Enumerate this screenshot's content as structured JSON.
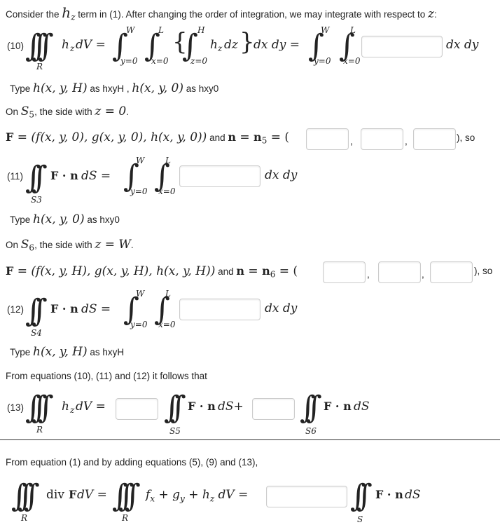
{
  "intro": {
    "text1": "Consider the ",
    "hz": "h",
    "z": "z",
    "text2": " term in (1). After changing the order of integration, we may integrate with respect to ",
    "var": "z",
    ":": ":"
  },
  "eq10": {
    "label": "(10)",
    "region": "R",
    "lhs": "h",
    "dv": " dV =",
    "W": "W",
    "L": "L",
    "H": "H",
    "y0": "y=0",
    "x0": "x=0",
    "z0": "z=0",
    "inner": "h",
    "dz": "dz",
    "dxdy": "dx dy =",
    "dxdy2": "dx dy"
  },
  "type1": {
    "pre": "Type ",
    "e1": "h(x, y, H)",
    "m1": " as hxyH , ",
    "e2": "h(x, y, 0)",
    "m2": " as hxy0"
  },
  "s5": {
    "pre": "On ",
    "S": "S",
    "sub": "5",
    "mid": ", the side with ",
    "eq": "z = 0",
    "post": "."
  },
  "f5": {
    "F": "F",
    "expr": " = (f(x, y, 0), g(x, y, 0), h(x, y, 0))",
    "and": " and ",
    "n": "n",
    "eq": " = ",
    "n5": "n",
    "sub": "5",
    "open": " = (",
    "comma": ",",
    "close": "), so"
  },
  "eq11": {
    "label": "(11)",
    "region": "S3",
    "Fn": "F · n",
    "dS": " dS =",
    "W": "W",
    "L": "L",
    "y0": "y=0",
    "x0": "x=0",
    "dxdy": "dx dy"
  },
  "type2": {
    "pre": "Type ",
    "e": "h(x, y, 0)",
    "post": " as hxy0"
  },
  "s6": {
    "pre": "On ",
    "S": "S",
    "sub": "6",
    "mid": ", the side with ",
    "eq": "z = W",
    "post": "."
  },
  "f6": {
    "F": "F",
    "expr": " = (f(x, y, H), g(x, y, H), h(x, y, H))",
    "and": " and ",
    "n": "n",
    "n6": "n",
    "sub": "6",
    "open": " = (",
    "comma": ",",
    "close": "), so"
  },
  "eq12": {
    "label": "(12)",
    "region": "S4",
    "Fn": "F · n",
    "dS": " dS =",
    "W": "W",
    "L": "L",
    "y0": "y=0",
    "x0": "x=0",
    "dxdy": "dx dy"
  },
  "type3": {
    "pre": "Type ",
    "e": "h(x, y, H)",
    "post": " as hxyH"
  },
  "from1": "From equations (10), (11) and (12) it follows that",
  "eq13": {
    "label": "(13)",
    "region": "R",
    "lhs": "h",
    "dv": " dV =",
    "Fn": "F · n",
    "dS1": " dS+",
    "dS2": " dS",
    "S5": "S5",
    "S6": "S6"
  },
  "from2": "From equation (1) and by adding equations (5), (9) and (13),",
  "final": {
    "div": "div",
    "F": "F",
    "dv": " dV =",
    "sum": "f",
    "x": "x",
    "plus1": " + g",
    "y": "y",
    "plus2": " + h",
    "z": "z",
    "dv2": " dV =",
    "R": "R",
    "Fn": "F · n",
    "dS": " dS",
    "S": "S"
  }
}
